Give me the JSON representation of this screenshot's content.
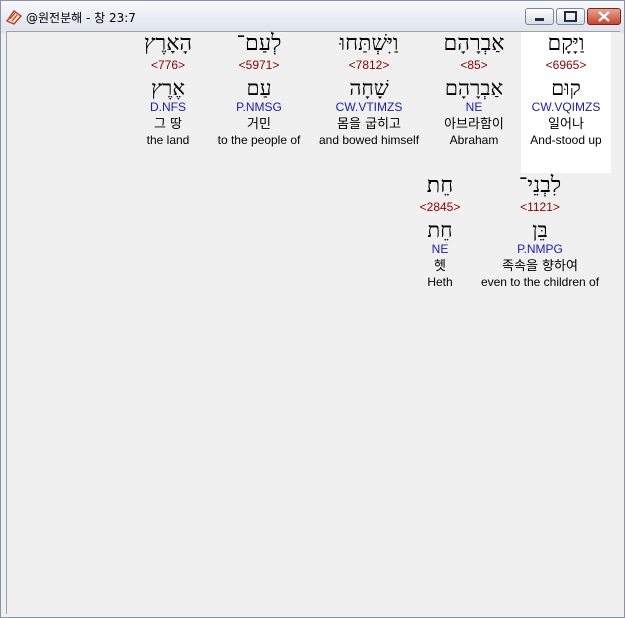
{
  "window": {
    "title": "@원전분해 - 창 23:7",
    "icon": "book-icon",
    "buttons": [
      "minimize-icon",
      "maximize-icon",
      "close-icon"
    ]
  },
  "colors": {
    "strong_number": "#8b0000",
    "morphology": "#1b1bb3",
    "highlight_bg": "#ffffff"
  },
  "words": [
    {
      "hebrew": "וַיָּקָם",
      "strong": "<6965>",
      "root": "קוּם",
      "morph": "CW.VQIMZS",
      "korean": "일어나",
      "english": "And-stood up",
      "selected": true
    },
    {
      "hebrew": "אַבְרָהָם",
      "strong": "<85>",
      "root": "אַבְרָהָם",
      "morph": "NE",
      "korean": "아브라함이",
      "english": "Abraham",
      "selected": false
    },
    {
      "hebrew": "וַיִּשְׁתַּחוּ",
      "strong": "<7812>",
      "root": "שָׁחָה",
      "morph": "CW.VTIMZS",
      "korean": "몸을 굽히고",
      "english": "and bowed himself",
      "selected": false
    },
    {
      "hebrew": "לְעַם־",
      "strong": "<5971>",
      "root": "עַם",
      "morph": "P.NMSG",
      "korean": "거민",
      "english": "to the people of",
      "selected": false
    },
    {
      "hebrew": "הָאָרֶץ",
      "strong": "<776>",
      "root": "אֶרֶץ",
      "morph": "D.NFS",
      "korean": "그 땅",
      "english": "the land",
      "selected": false
    },
    {
      "hebrew": "לִבְנֵי־",
      "strong": "<1121>",
      "root": "בֵּן",
      "morph": "P.NMPG",
      "korean": "족속을 향하여",
      "english": "even to the children of",
      "selected": false
    },
    {
      "hebrew": "חֵת׃",
      "strong": "<2845>",
      "root": "חֵת",
      "morph": "NE",
      "korean": "헷",
      "english": "Heth",
      "selected": false
    }
  ]
}
